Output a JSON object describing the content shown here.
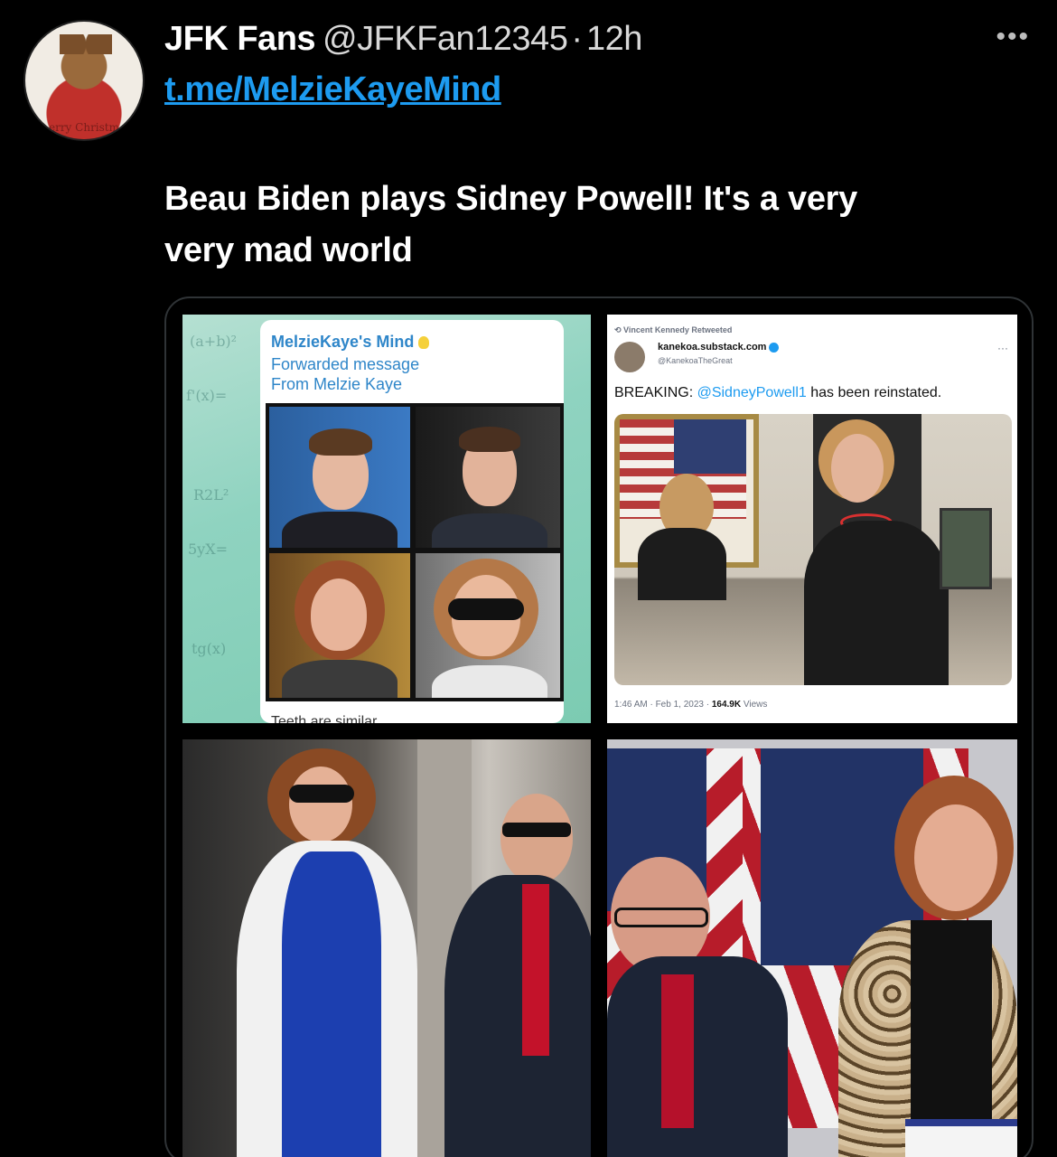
{
  "tweet": {
    "author_name": "JFK Fans",
    "handle": "@JFKFan12345",
    "separator": "·",
    "time": "12h",
    "more_icon": "more-dots-icon",
    "more_glyph": "•••",
    "link": "t.me/MelzieKayeMind",
    "text_line1": "Beau Biden plays Sidney Powell! It's a very",
    "text_line2": "very mad world",
    "avatar_caption": "erry Christm"
  },
  "media": {
    "telegram": {
      "title": "MelzieKaye's Mind",
      "bulb_icon": "lightbulb-icon",
      "forwarded_line1": "Forwarded message",
      "forwarded_line2": "From Melzie Kaye",
      "footer": "Teeth are similar"
    },
    "embedded_tweet": {
      "retweet_line": "Vincent Kennedy Retweeted",
      "name": "kanekoa.substack.com",
      "handle": "@KanekoaTheGreat",
      "text_prefix": "BREAKING: ",
      "mention": "@SidneyPowell1",
      "text_suffix": " has been reinstated.",
      "meta_time": "1:46 AM · Feb 1, 2023 · ",
      "meta_views": "164.9K",
      "meta_views_label": " Views"
    }
  },
  "colors": {
    "link": "#1d9bf0",
    "background": "#000000",
    "text": "#ffffff"
  }
}
